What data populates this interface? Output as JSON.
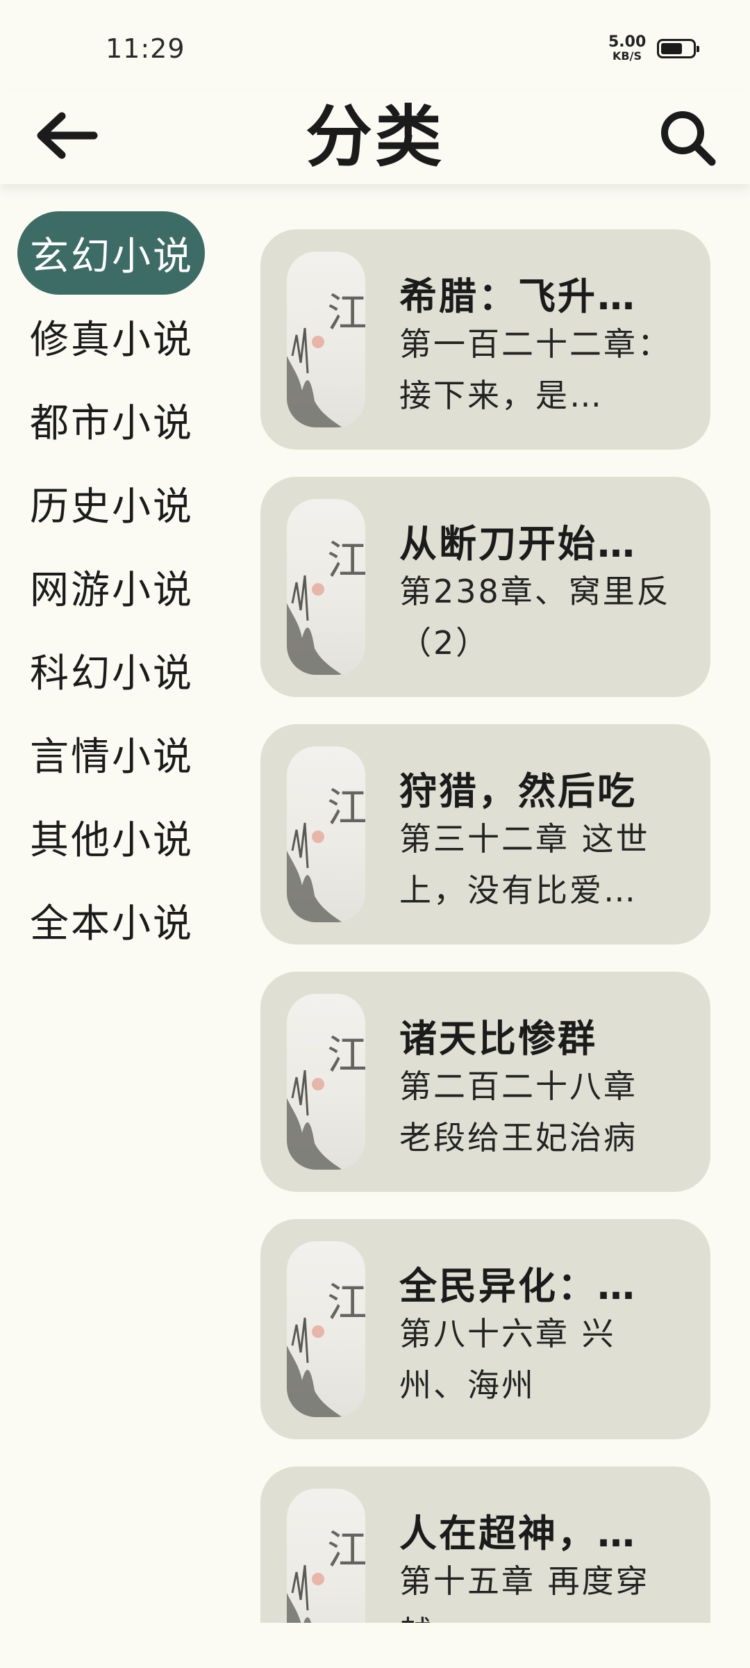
{
  "status_bar": {
    "time": "11:29",
    "net_speed_value": "5.00",
    "net_speed_unit": "KB/S",
    "battery_icon": "battery-icon"
  },
  "header": {
    "title": "分类",
    "back_icon": "arrow-left-icon",
    "search_icon": "search-icon"
  },
  "categories": [
    {
      "label": "玄幻小说",
      "active": true
    },
    {
      "label": "修真小说",
      "active": false
    },
    {
      "label": "都市小说",
      "active": false
    },
    {
      "label": "历史小说",
      "active": false
    },
    {
      "label": "网游小说",
      "active": false
    },
    {
      "label": "科幻小说",
      "active": false
    },
    {
      "label": "言情小说",
      "active": false
    },
    {
      "label": "其他小说",
      "active": false
    },
    {
      "label": "全本小说",
      "active": false
    }
  ],
  "books": [
    {
      "title": "希腊：飞升…",
      "chapter": "第一百二十二章：接下来，是…"
    },
    {
      "title": "从断刀开始…",
      "chapter": "第238章、窝里反（2）"
    },
    {
      "title": "狩猎，然后吃",
      "chapter": "第三十二章 这世上，没有比爱…"
    },
    {
      "title": "诸天比惨群",
      "chapter": "第二百二十八章 老段给王妃治病"
    },
    {
      "title": "全民异化：…",
      "chapter": "第八十六章 兴州、海州"
    },
    {
      "title": "人在超神，…",
      "chapter": "第十五章 再度穿越"
    }
  ],
  "cover": {
    "icon": "book-cover-image",
    "calligraphy": "江湖"
  },
  "colors": {
    "background": "#fbfbf4",
    "accent": "#3d6b66",
    "card": "#dfe0d3",
    "text": "#1b1b1b"
  }
}
